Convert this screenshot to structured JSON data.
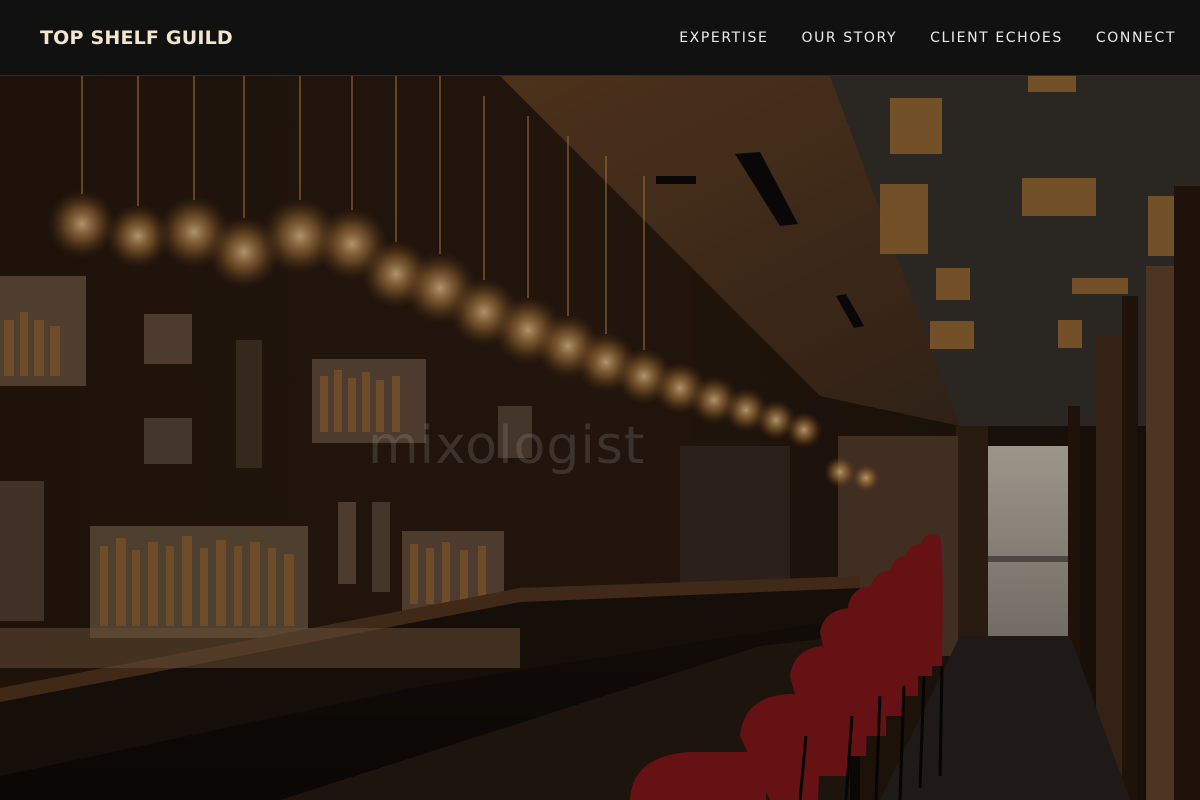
{
  "nav": {
    "brand": "TOP SHELF GUILD",
    "links": [
      "EXPERTISE",
      "OUR STORY",
      "CLIENT ECHOES",
      "CONNECT"
    ]
  },
  "hero": {
    "watermark": "mixologist",
    "image_description_icon": "bar-interior-photo"
  },
  "colors": {
    "nav_bg": "#111111",
    "brand": "#f3e6cf",
    "nav_text": "#ececec",
    "stool_red": "#9e1c1e"
  }
}
